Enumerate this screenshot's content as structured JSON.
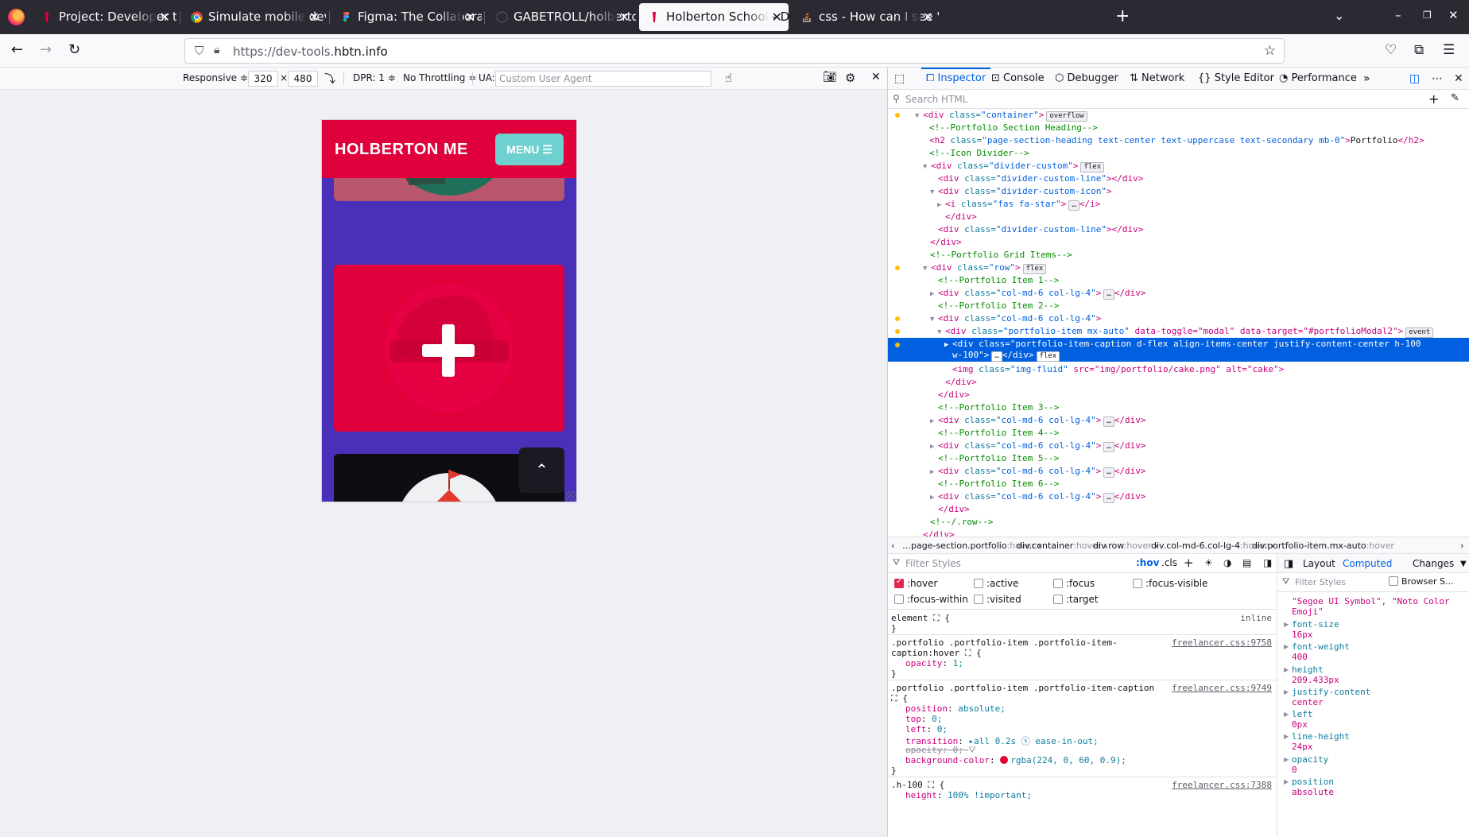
{
  "tabs": [
    {
      "title": "Project: Developer tools |",
      "active": false
    },
    {
      "title": "Simulate mobile devices",
      "active": false
    },
    {
      "title": "Figma: The Collaborative",
      "active": false
    },
    {
      "title": "GABETROLL/holbertonsc",
      "active": false
    },
    {
      "title": "Holberton School - Devel",
      "active": true
    },
    {
      "title": "css - How can I see \":hove",
      "active": false
    }
  ],
  "navbar": {
    "url_prefix": "https://dev-tools.",
    "url_domain": "hbtn.info"
  },
  "rdm": {
    "device": "Responsive ≑",
    "width": "320",
    "times": "×",
    "height": "480",
    "dpr": "DPR: 1 ≑",
    "throttling": "No Throttling ≑",
    "ua_label": "UA:",
    "ua_placeholder": "Custom User Agent"
  },
  "site": {
    "brand": "HOLBERTON ME",
    "menu_label": "MENU ☰"
  },
  "devtools": {
    "tabs": [
      "Inspector",
      "Console",
      "Debugger",
      "Network",
      "Style Editor",
      "Performance"
    ],
    "search_placeholder": "Search HTML"
  },
  "markup_lines": [
    {
      "html_tag": "<div ",
      "attr": "class=",
      "val": "\"container\"",
      "end": ">",
      "badge": "overflow"
    },
    {
      "comment": "<!--Portfolio Section Heading-->"
    },
    {
      "html_tag": "<h2 ",
      "attr": "class=",
      "val": "\"page-section-heading text-center text-uppercase text-secondary mb-0\"",
      "end": ">",
      "text": "Portfolio",
      "close": "</h2>"
    },
    {
      "comment": "<!--Icon Divider-->"
    },
    {
      "html_tag": "<div ",
      "attr": "class=",
      "val": "\"divider-custom\"",
      "end": ">",
      "badge": "flex"
    },
    {
      "html_tag": "<div ",
      "attr": "class=",
      "val": "\"divider-custom-line\"",
      "end": ">",
      "close": "</div>"
    },
    {
      "html_tag": "<div ",
      "attr": "class=",
      "val": "\"divider-custom-icon\"",
      "end": ">"
    },
    {
      "html_tag": "<i ",
      "attr": "class=",
      "val": "\"fas fa-star\"",
      "end": ">",
      "text": "…",
      "close": "</i>"
    },
    {
      "close": "</div>"
    },
    {
      "html_tag": "<div ",
      "attr": "class=",
      "val": "\"divider-custom-line\"",
      "end": ">",
      "close": "</div>"
    },
    {
      "close": "</div>"
    },
    {
      "comment": "<!--Portfolio Grid Items-->"
    },
    {
      "html_tag": "<div ",
      "attr": "class=",
      "val": "\"row\"",
      "end": ">",
      "badge": "flex"
    },
    {
      "comment": "<!--Portfolio Item 1-->"
    },
    {
      "html_tag": "<div ",
      "attr": "class=",
      "val": "\"col-md-6 col-lg-4\"",
      "end": ">",
      "text": "…",
      "close": "</div>"
    },
    {
      "comment": "<!--Portfolio Item 2-->"
    },
    {
      "html_tag": "<div ",
      "attr": "class=",
      "val": "\"col-md-6 col-lg-4\"",
      "end": ">"
    },
    {
      "html_tag": "<div ",
      "attr": "class=",
      "val": "\"portfolio-item mx-auto\"",
      "end": " data-toggle=\"modal\" data-target=\"#portfolioModal2\">",
      "badge": "event"
    },
    {
      "html_tag": "<div ",
      "attr": "class=",
      "val": "\"portfolio-item-caption d-flex align-items-center justify-content-center h-100",
      "line2": "w-100\">",
      "text": "…",
      "close": "</div>",
      "badge": "flex"
    },
    {
      "html_tag": "<img ",
      "attr": "class=",
      "val": "\"img-fluid\"",
      "end": " src=\"img/portfolio/cake.png\" alt=\"cake\">"
    },
    {
      "close": "</div>"
    },
    {
      "close": "</div>"
    },
    {
      "comment": "<!--Portfolio Item 3-->"
    },
    {
      "html_tag": "<div ",
      "attr": "class=",
      "val": "\"col-md-6 col-lg-4\"",
      "end": ">",
      "text": "…",
      "close": "</div>"
    },
    {
      "comment": "<!--Portfolio Item 4-->"
    },
    {
      "html_tag": "<div ",
      "attr": "class=",
      "val": "\"col-md-6 col-lg-4\"",
      "end": ">",
      "text": "…",
      "close": "</div>"
    },
    {
      "comment": "<!--Portfolio Item 5-->"
    },
    {
      "html_tag": "<div ",
      "attr": "class=",
      "val": "\"col-md-6 col-lg-4\"",
      "end": ">",
      "text": "…",
      "close": "</div>"
    },
    {
      "comment": "<!--Portfolio Item 6-->"
    },
    {
      "html_tag": "<div ",
      "attr": "class=",
      "val": "\"col-md-6 col-lg-4\"",
      "end": ">",
      "text": "…",
      "close": "</div>"
    },
    {
      "close": "</div>"
    },
    {
      "comment": "<!--/.row-->"
    },
    {
      "close": "</div>"
    }
  ],
  "breadcrumbs": [
    {
      "tag": "…page-section.portfolio",
      "pseudo": ":hover"
    },
    {
      "tag": "div.container",
      "pseudo": ":hover"
    },
    {
      "tag": "div.row",
      "pseudo": ":hover"
    },
    {
      "tag": "div.col-md-6.col-lg-4",
      "pseudo": ":hover"
    },
    {
      "tag": "div.portfolio-item.mx-auto",
      "pseudo": ":hover"
    }
  ],
  "rules": {
    "filter_placeholder": "Filter Styles",
    "hov": ":hov",
    "cls": ".cls",
    "pseudo_classes": [
      {
        "label": ":hover",
        "checked": true
      },
      {
        "label": ":active",
        "checked": false
      },
      {
        "label": ":focus",
        "checked": false
      },
      {
        "label": ":focus-visible",
        "checked": false
      },
      {
        "label": ":focus-within",
        "checked": false
      },
      {
        "label": ":visited",
        "checked": false
      },
      {
        "label": ":target",
        "checked": false
      }
    ],
    "element_selector": "element ⛶ {",
    "element_inline": "inline",
    "rule1_selector_a": ".portfolio .portfolio-item .portfolio-item-",
    "rule1_selector_b": "caption:hover ⛶ {",
    "rule1_src": "freelancer.css:9758",
    "rule1_prop": "opacity",
    "rule1_val": "1;",
    "rule2_selector": ".portfolio .portfolio-item .portfolio-item-caption",
    "rule2_src": "freelancer.css:9749",
    "rule2_props": [
      {
        "prop": "position",
        "val": "absolute;"
      },
      {
        "prop": "top",
        "val": "0;"
      },
      {
        "prop": "left",
        "val": "0;"
      },
      {
        "prop": "transition",
        "val": "▸all 0.2s ⓢ ease-in-out;"
      },
      {
        "prop": "opacity",
        "val": "0;",
        "strike": true
      },
      {
        "prop": "background-color",
        "val": "rgba(224, 0, 60, 0.9);"
      }
    ],
    "rule3_selector": ".h-100 ⛶ {",
    "rule3_src": "freelancer.css:7388",
    "rule3_prop": "height",
    "rule3_val": "100% !important;",
    "brace_open": "⛶ {",
    "brace_close": "}"
  },
  "computed": {
    "tabs": [
      "Layout",
      "Computed",
      "Changes"
    ],
    "filter_placeholder": "Filter Styles",
    "browser_styles": "Browser S...",
    "font_tail_1": "\"Segoe UI Symbol\", \"Noto Color",
    "font_tail_2": "Emoji\"",
    "props": [
      {
        "name": "font-size",
        "value": "16px"
      },
      {
        "name": "font-weight",
        "value": "400"
      },
      {
        "name": "height",
        "value": "209.433px"
      },
      {
        "name": "justify-content",
        "value": "center"
      },
      {
        "name": "left",
        "value": "0px"
      },
      {
        "name": "line-height",
        "value": "24px"
      },
      {
        "name": "opacity",
        "value": "0"
      },
      {
        "name": "position",
        "value": "absolute"
      }
    ]
  },
  "colors": {
    "accent": "#0061e0",
    "site_primary": "#e0003c",
    "site_bg": "#4a2fb8"
  }
}
